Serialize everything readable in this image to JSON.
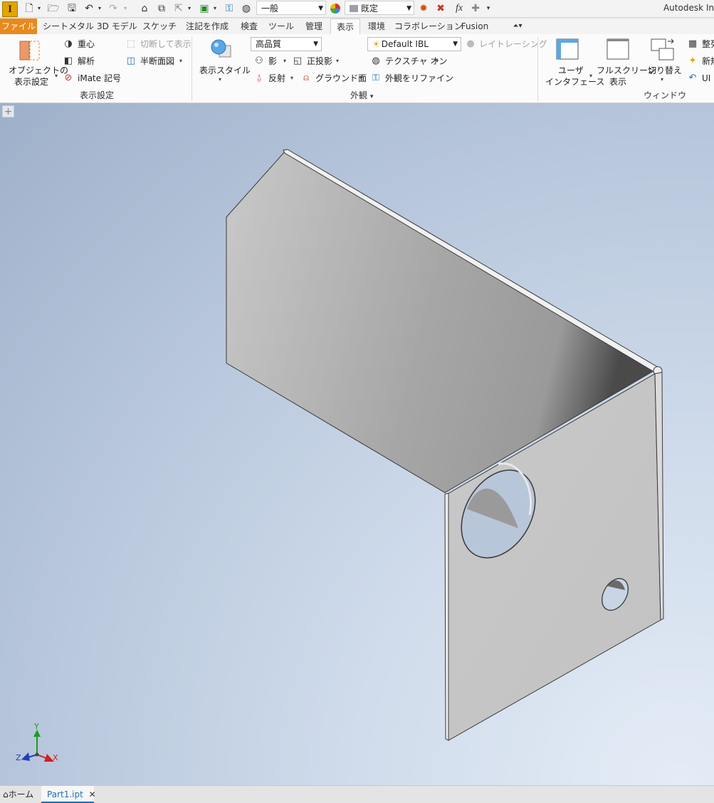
{
  "app": {
    "title": "Autodesk In",
    "logo_letter": "I"
  },
  "qat": {
    "style_dropdown": "一般",
    "appearance_dropdown": "既定",
    "fx_label": "fx"
  },
  "tabs": [
    {
      "label": "ファイル"
    },
    {
      "label": "シートメタル"
    },
    {
      "label": "3D モデル"
    },
    {
      "label": "スケッチ"
    },
    {
      "label": "注記を作成"
    },
    {
      "label": "検査"
    },
    {
      "label": "ツール"
    },
    {
      "label": "管理"
    },
    {
      "label": "表示"
    },
    {
      "label": "環境"
    },
    {
      "label": "コラボレーション"
    },
    {
      "label": "Fusion"
    }
  ],
  "ribbon": {
    "visibility": {
      "object_visibility": "オブジェクトの",
      "object_visibility2": "表示設定",
      "center_of_gravity": "重心",
      "analysis": "解析",
      "imate": "iMate 記号",
      "section_cut": "切断して表示",
      "half_section": "半断面図",
      "group_label": "表示設定"
    },
    "appearance": {
      "visual_style": "表示スタイル",
      "quality_dropdown": "高品質",
      "shadow": "影",
      "orthographic": "正投影",
      "reflection": "反射",
      "ground_plane": "グラウンド面",
      "ibl_dropdown": "Default IBL",
      "ray_tracing": "レイトレーシング",
      "texture_on": "テクスチャ オン",
      "refine_appearance": "外観をリファイン",
      "group_label": "外観"
    },
    "window": {
      "user_interface": "ユーザ",
      "user_interface2": "インタフェース",
      "full_screen": "フルスクリーン",
      "full_screen2": "表示",
      "switch": "切り替え",
      "arrange": "整列",
      "new_window": "新規",
      "ui_reset": "UI",
      "group_label": "ウィンドウ"
    }
  },
  "viewport": {
    "plus_label": "+",
    "triad": {
      "x": "X",
      "y": "Y",
      "z": "Z"
    },
    "colors": {
      "x_axis": "#d32020",
      "y_axis": "#1f9a1f",
      "z_axis": "#1f3fc0",
      "accent": "#e8891c"
    }
  },
  "document_tabs": {
    "home": "ホーム",
    "part": "Part1.ipt",
    "close_glyph": "✕"
  }
}
